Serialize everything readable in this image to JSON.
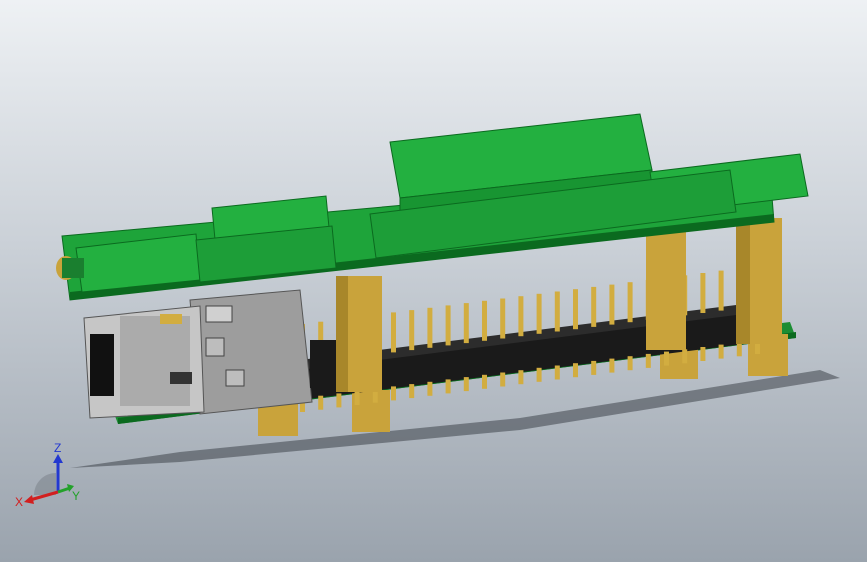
{
  "viewport": {
    "background_top": "#eef1f4",
    "background_bottom": "#9aa3ad"
  },
  "model": {
    "description_icon": "pcb-assembly-3d-model",
    "pcb_color": "#1aa23a",
    "pcb_dark": "#0b6a1f",
    "standoff_color": "#c9a33b",
    "header_color": "#1a1a1a",
    "pin_color": "#d2ad40",
    "connector_color": "#a7a7a7"
  },
  "triad": {
    "x_label": "X",
    "y_label": "Y",
    "z_label": "Z",
    "x_color": "#d21f1f",
    "y_color": "#23a12a",
    "z_color": "#2338d0"
  }
}
